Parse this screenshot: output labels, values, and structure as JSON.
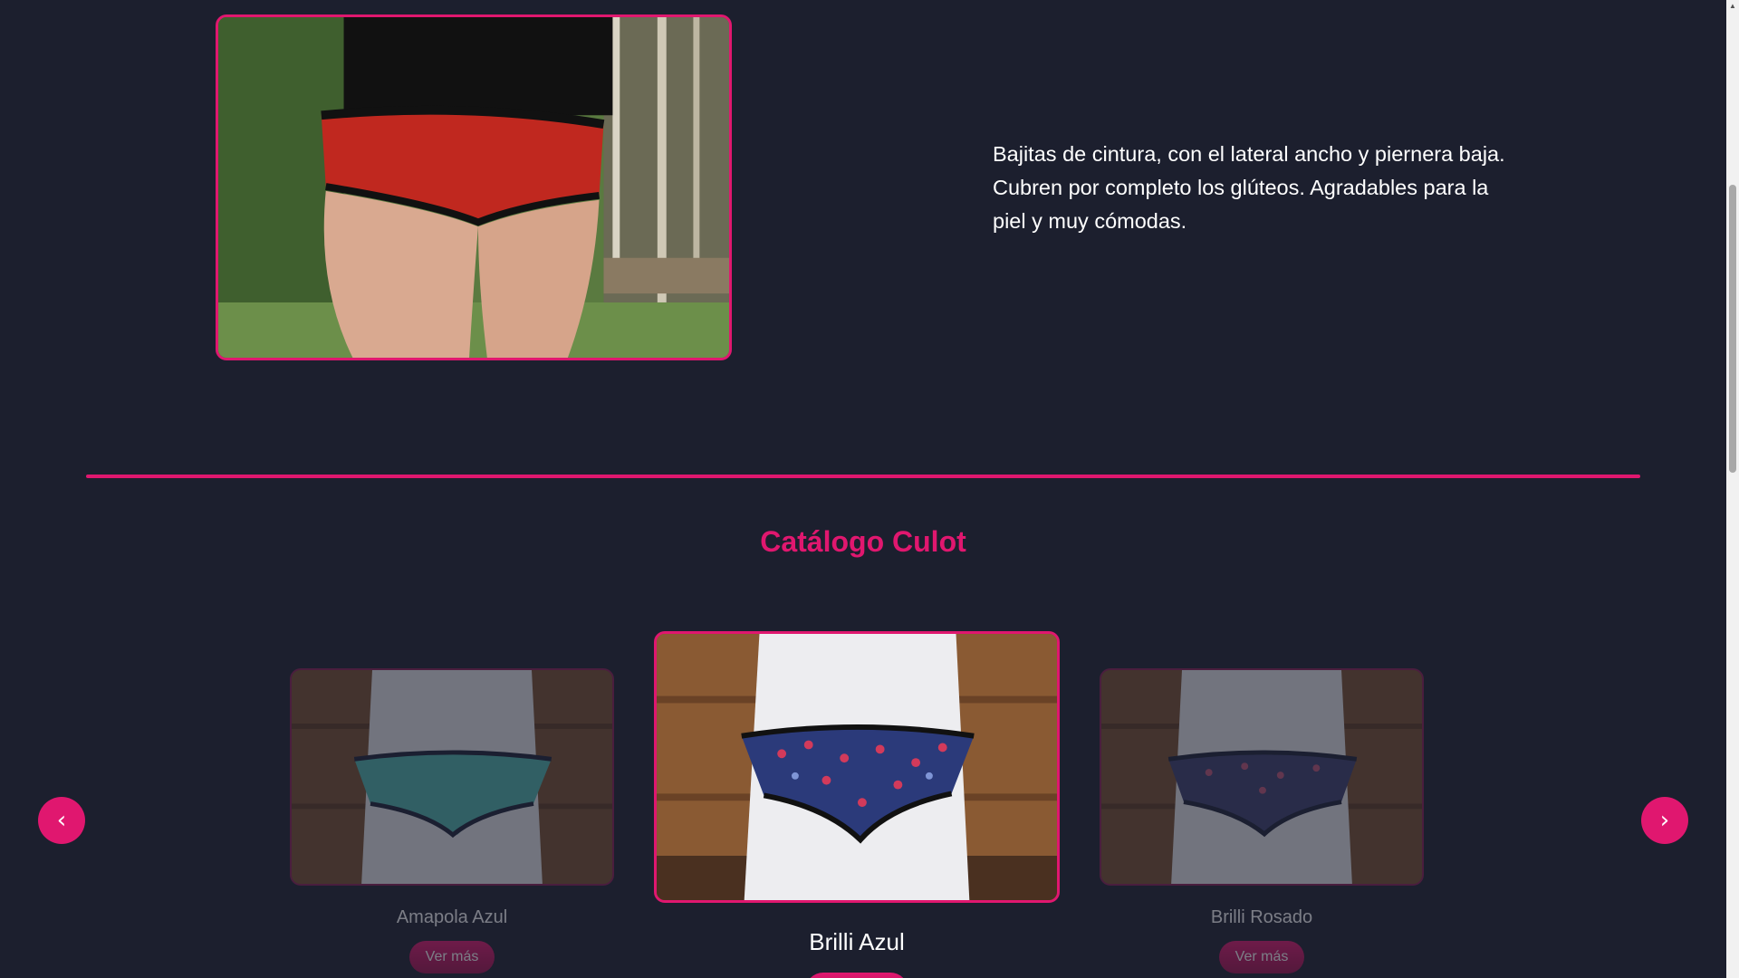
{
  "hero": {
    "description": "Bajitas de cintura, con el lateral ancho y piernera baja. Cubren por completo los glúteos. Agradables para la piel y muy cómodas."
  },
  "catalog": {
    "title": "Catálogo Culot",
    "prev_label": "‹",
    "next_label": "›",
    "items": [
      {
        "name": "Amapola Azul",
        "button": "Ver más",
        "pattern_color": "#4fb7ae"
      },
      {
        "name": "Brilli Azul",
        "button": "",
        "pattern_color": "#2b3a7a"
      },
      {
        "name": "Brilli Rosado",
        "button": "Ver más",
        "pattern_color": "#3b3f6e"
      }
    ]
  },
  "colors": {
    "background": "#1c1f2e",
    "accent": "#e0176f"
  },
  "scrollbar": {
    "up_arrow": "▲"
  }
}
